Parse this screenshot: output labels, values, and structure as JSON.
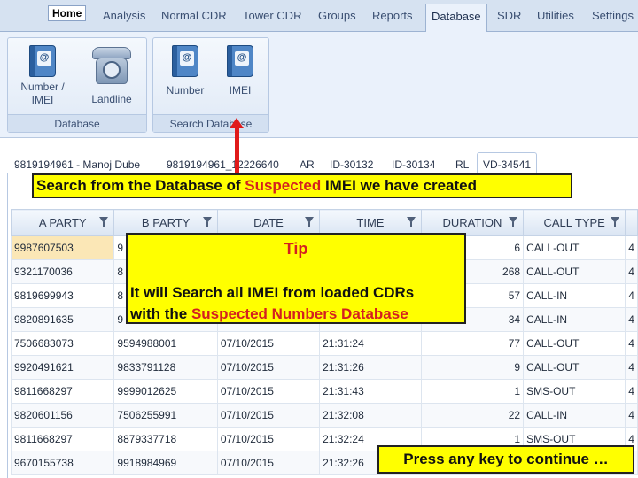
{
  "menu": {
    "home": "Home",
    "tabs": [
      "Analysis",
      "Normal CDR",
      "Tower CDR",
      "Groups",
      "Reports",
      "Database",
      "SDR",
      "Utilities",
      "Settings"
    ],
    "active": "Database"
  },
  "ribbon": {
    "database_group": {
      "title": "Database",
      "buttons": [
        {
          "label1": "Number /",
          "label2": "IMEI",
          "icon": "address-book-icon"
        },
        {
          "label1": "Landline",
          "label2": "",
          "icon": "telephone-icon"
        }
      ]
    },
    "search_group": {
      "title": "Search Database",
      "buttons": [
        {
          "label1": "Number",
          "icon": "address-book-icon"
        },
        {
          "label1": "IMEI",
          "icon": "address-book-icon"
        }
      ]
    }
  },
  "tabs_row": [
    "9819194961 - Manoj Dube",
    "9819194961_12226640",
    "AR",
    "ID-30132",
    "ID-30134",
    "RL",
    "VD-34541"
  ],
  "grid": {
    "columns": [
      "A PARTY",
      "B PARTY",
      "DATE",
      "TIME",
      "DURATION",
      "CALL TYPE"
    ],
    "rows": [
      [
        "9987607503",
        "9",
        "",
        "",
        "6",
        "CALL-OUT",
        "4"
      ],
      [
        "9321170036",
        "8",
        "",
        "",
        "268",
        "CALL-OUT",
        "4"
      ],
      [
        "9819699943",
        "8",
        "",
        "",
        "57",
        "CALL-IN",
        "4"
      ],
      [
        "9820891635",
        "9",
        "",
        "",
        "34",
        "CALL-IN",
        "4"
      ],
      [
        "7506683073",
        "9594988001",
        "07/10/2015",
        "21:31:24",
        "77",
        "CALL-OUT",
        "4"
      ],
      [
        "9920491621",
        "9833791128",
        "07/10/2015",
        "21:31:26",
        "9",
        "CALL-OUT",
        "4"
      ],
      [
        "9811668297",
        "9999012625",
        "07/10/2015",
        "21:31:43",
        "1",
        "SMS-OUT",
        "4"
      ],
      [
        "9820601156",
        "7506255991",
        "07/10/2015",
        "21:32:08",
        "22",
        "CALL-IN",
        "4"
      ],
      [
        "9811668297",
        "8879337718",
        "07/10/2015",
        "21:32:24",
        "1",
        "SMS-OUT",
        "4"
      ],
      [
        "9670155738",
        "9918984969",
        "07/10/2015",
        "21:32:26",
        "",
        "",
        ""
      ]
    ]
  },
  "annotations": {
    "callout_prefix": "Search from the Database of ",
    "callout_highlight": "Suspected",
    "callout_suffix": " IMEI we have created",
    "tip_title": "Tip",
    "tip_line1": "It will Search all IMEI from loaded CDRs",
    "tip_line2_prefix": "with the ",
    "tip_line2_highlight": "Suspected Numbers Database",
    "continue": "Press any key to continue …"
  },
  "colors": {
    "highlight_yellow": "#ffff00",
    "accent_red": "#e01a1a",
    "selected_cell": "#fbe7b6"
  }
}
